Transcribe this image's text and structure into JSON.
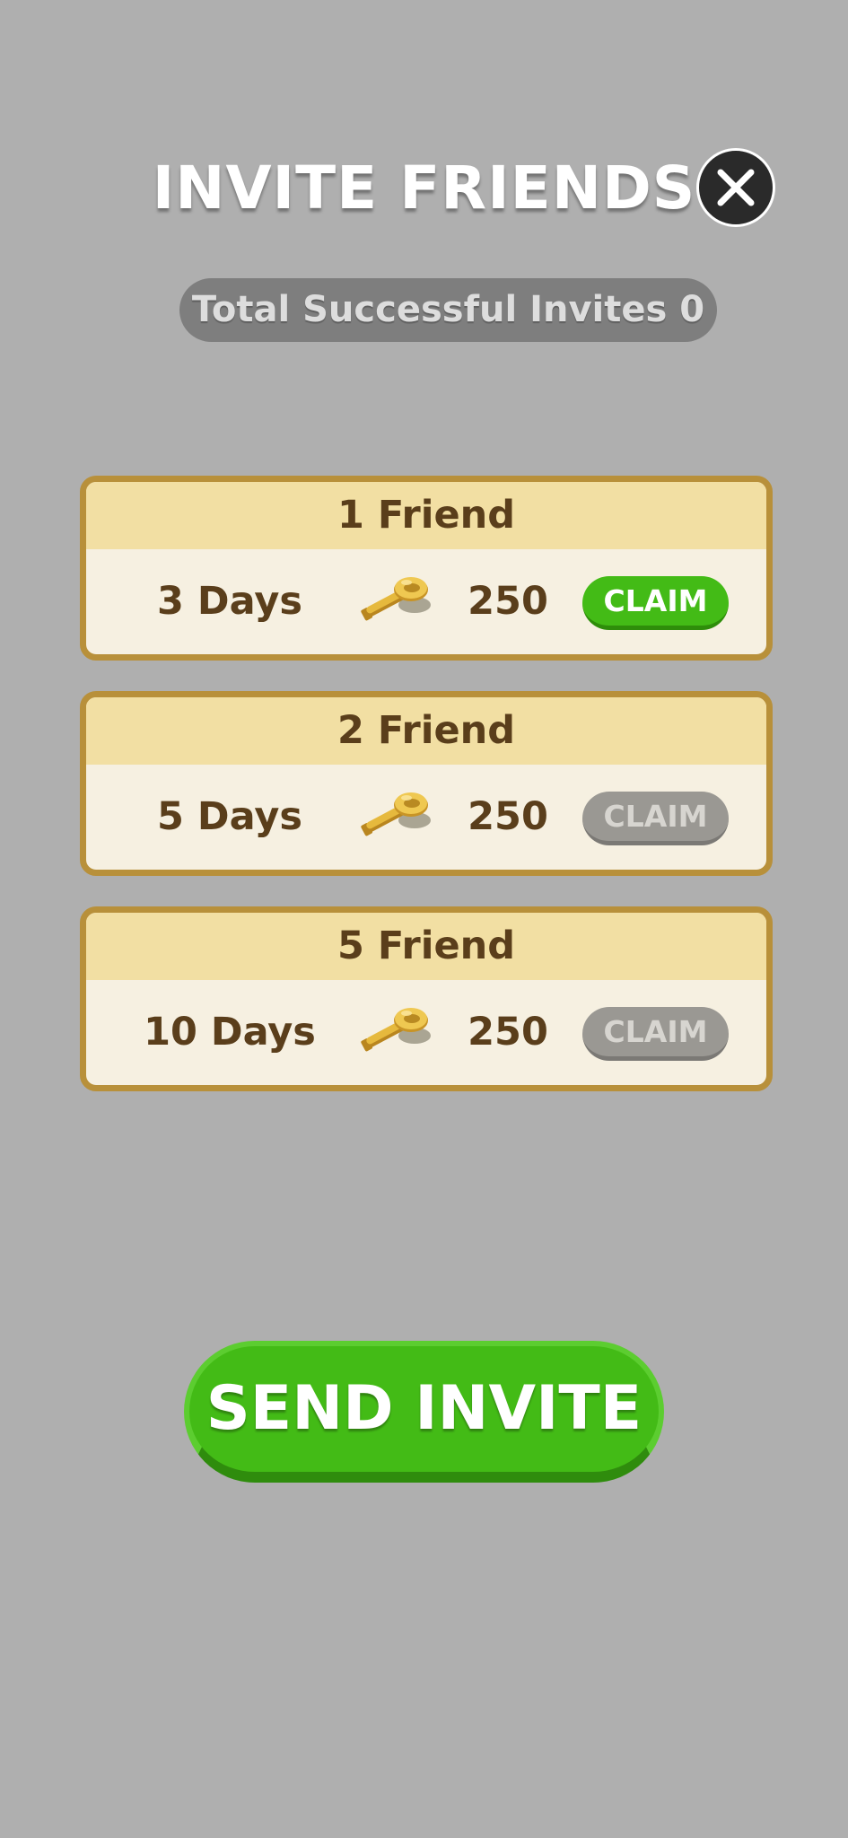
{
  "header": {
    "title": "INVITE FRIENDS",
    "close_icon": "close-icon"
  },
  "stats": {
    "total_invites_label": "Total Successful Invites 0"
  },
  "rewards": [
    {
      "friends_label": "1 Friend",
      "days": "3 Days",
      "reward_icon": "key-icon",
      "amount": "250",
      "claim_label": "CLAIM",
      "claim_enabled": true
    },
    {
      "friends_label": "2 Friend",
      "days": "5 Days",
      "reward_icon": "key-icon",
      "amount": "250",
      "claim_label": "CLAIM",
      "claim_enabled": false
    },
    {
      "friends_label": "5 Friend",
      "days": "10 Days",
      "reward_icon": "key-icon",
      "amount": "250",
      "claim_label": "CLAIM",
      "claim_enabled": false
    }
  ],
  "actions": {
    "send_invite_label": "SEND INVITE"
  },
  "colors": {
    "background": "#afafaf",
    "accent_green": "#43bb16",
    "card_border": "#b8903a",
    "card_header": "#f2dfa3",
    "card_body": "#f6f0e1",
    "text_brown": "#5a3e1b",
    "disabled_gray": "#9a9893"
  }
}
